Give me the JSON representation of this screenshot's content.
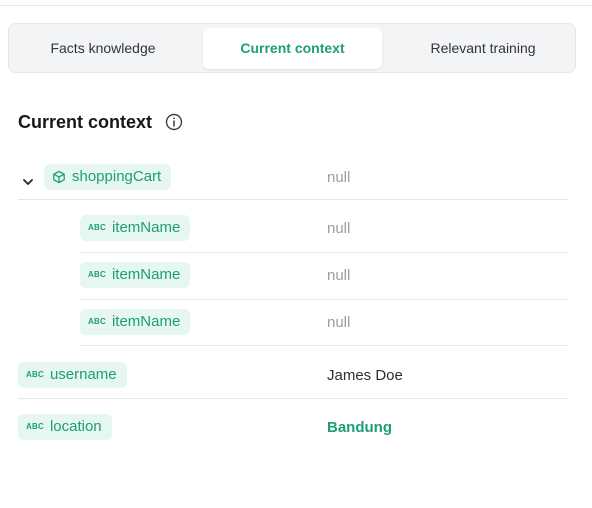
{
  "tabs": [
    {
      "label": "Facts knowledge"
    },
    {
      "label": "Current context"
    },
    {
      "label": "Relevant training"
    }
  ],
  "section": {
    "title": "Current context",
    "info_icon": "info-icon"
  },
  "rows": {
    "shoppingCart": {
      "name": "shoppingCart",
      "value": "null",
      "type_icon": "cube-icon"
    },
    "items": [
      {
        "name": "itemName",
        "value": "null",
        "type_icon": "abc"
      },
      {
        "name": "itemName",
        "value": "null",
        "type_icon": "abc"
      },
      {
        "name": "itemName",
        "value": "null",
        "type_icon": "abc"
      }
    ],
    "username": {
      "name": "username",
      "value": "James Doe",
      "type_icon": "abc"
    },
    "location": {
      "name": "location",
      "value": "Bandung",
      "type_icon": "abc"
    }
  },
  "icon_text": {
    "abc": "ABC"
  },
  "colors": {
    "accent": "#1f9d7a",
    "chip_bg": "#e6f6f1",
    "null_text": "#9aa0a6"
  }
}
